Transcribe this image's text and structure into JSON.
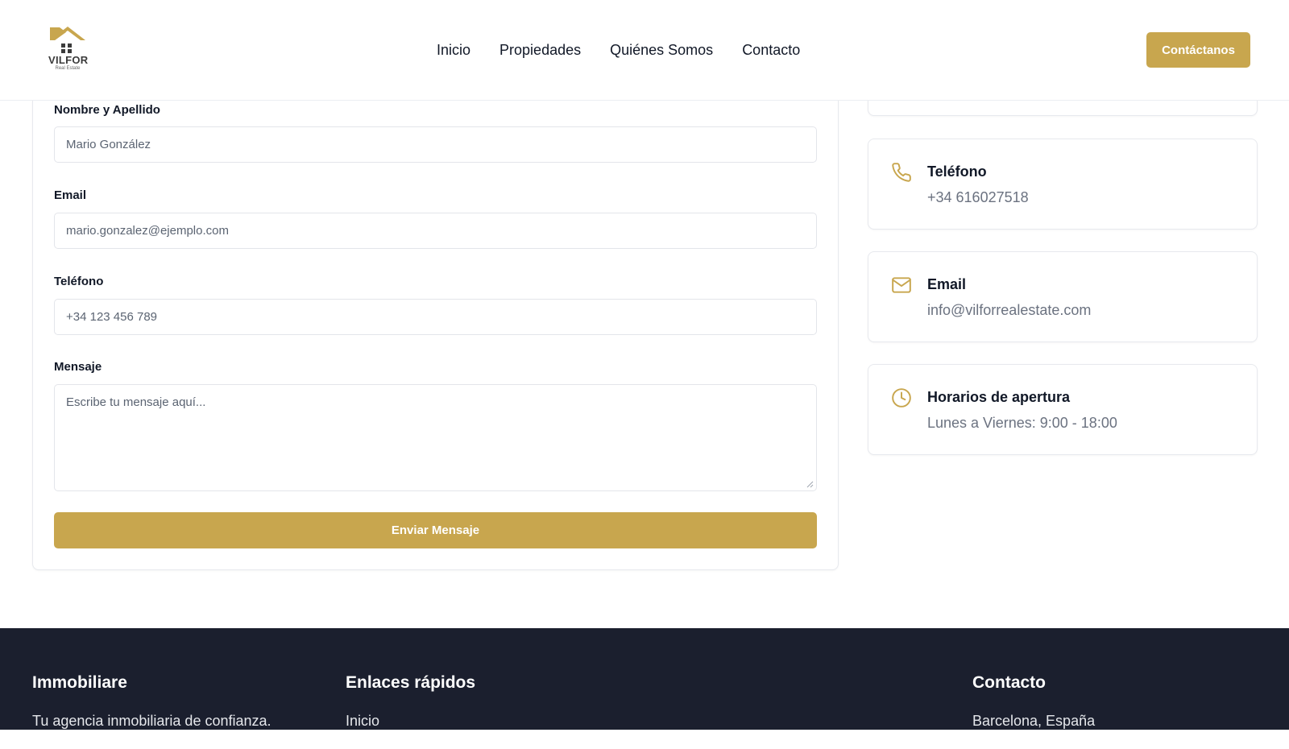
{
  "brand": {
    "logo_text": "VILFOR",
    "logo_subtext": "Real Estate",
    "accent_color": "#c8a64e"
  },
  "nav": {
    "items": [
      "Inicio",
      "Propiedades",
      "Quiénes Somos",
      "Contacto"
    ],
    "cta_label": "Contáctanos"
  },
  "form": {
    "name_label": "Nombre y Apellido",
    "name_placeholder": "Mario González",
    "email_label": "Email",
    "email_placeholder": "mario.gonzalez@ejemplo.com",
    "phone_label": "Teléfono",
    "phone_placeholder": "+34 123 456 789",
    "message_label": "Mensaje",
    "message_placeholder": "Escribe tu mensaje aquí...",
    "submit_label": "Enviar Mensaje"
  },
  "info": {
    "phone": {
      "title": "Teléfono",
      "value": "+34 616027518",
      "icon": "phone-icon"
    },
    "email": {
      "title": "Email",
      "value": "info@vilforrealestate.com",
      "icon": "mail-icon"
    },
    "hours": {
      "title": "Horarios de apertura",
      "value": "Lunes a Viernes: 9:00 - 18:00",
      "icon": "clock-icon"
    }
  },
  "footer": {
    "brand_title": "Immobiliare",
    "brand_tagline": "Tu agencia inmobiliaria de confianza.",
    "links_title": "Enlaces rápidos",
    "links": [
      "Inicio"
    ],
    "contact_title": "Contacto",
    "contact_address": "Barcelona, España"
  }
}
